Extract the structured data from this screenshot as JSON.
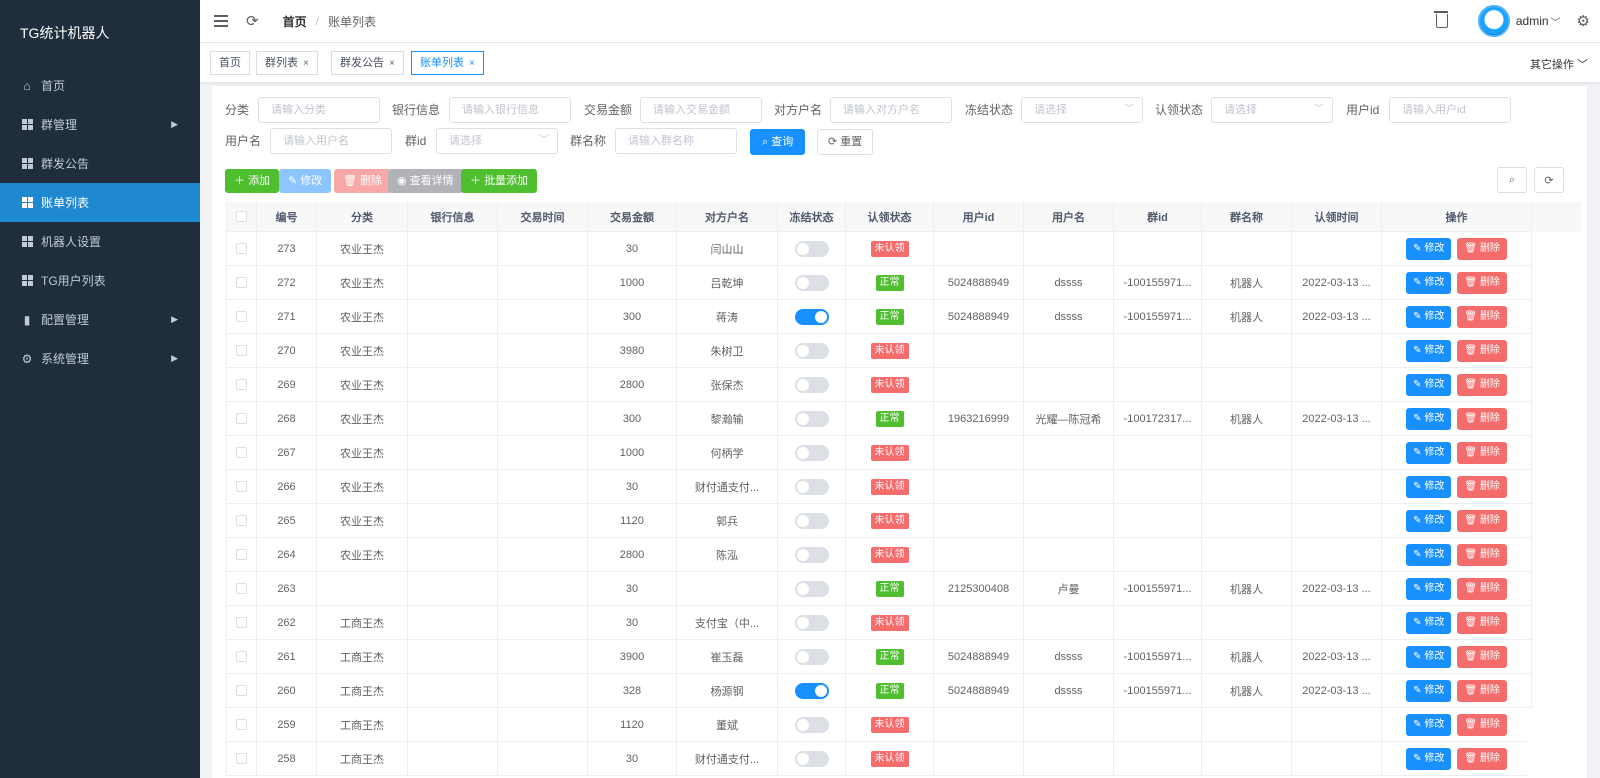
{
  "sidebar": {
    "title": "TG统计机器人",
    "items": [
      {
        "label": "首页",
        "icon": "home-icon"
      },
      {
        "label": "群管理",
        "icon": "grid-icon",
        "arrow": true
      },
      {
        "label": "群发公告",
        "icon": "grid-icon"
      },
      {
        "label": "账单列表",
        "icon": "grid-icon",
        "active": true
      },
      {
        "label": "机器人设置",
        "icon": "grid-icon"
      },
      {
        "label": "TG用户列表",
        "icon": "grid-icon"
      },
      {
        "label": "配置管理",
        "icon": "bar-chart-icon",
        "arrow": true
      },
      {
        "label": "系统管理",
        "icon": "gear-icon",
        "arrow": true
      }
    ]
  },
  "navbar": {
    "breadcrumb_home": "首页",
    "breadcrumb_sep": "/",
    "breadcrumb_current": "账单列表",
    "username": "admin"
  },
  "tags": {
    "items": [
      {
        "label": "首页"
      },
      {
        "label": "群列表",
        "closable": true
      },
      {
        "label": "群发公告",
        "closable": true
      },
      {
        "label": "账单列表",
        "closable": true,
        "active": true
      }
    ],
    "other_ops": "其它操作"
  },
  "filters": {
    "category_label": "分类",
    "category_placeholder": "请输入分类",
    "bank_label": "银行信息",
    "bank_placeholder": "请输入银行信息",
    "amount_label": "交易金额",
    "amount_placeholder": "请输入交易金额",
    "peer_label": "对方户名",
    "peer_placeholder": "请输入对方户名",
    "freeze_label": "冻结状态",
    "freeze_placeholder": "请选择",
    "claim_label": "认领状态",
    "claim_placeholder": "请选择",
    "userid_label": "用户id",
    "userid_placeholder": "请输入用户id",
    "username_label": "用户名",
    "username_placeholder": "请输入用户名",
    "groupid_label": "群id",
    "groupid_placeholder": "请选择",
    "groupname_label": "群名称",
    "groupname_placeholder": "请输入群名称",
    "search_btn": "查询",
    "reset_btn": "重置"
  },
  "toolbar": {
    "add": "添加",
    "edit": "修改",
    "delete": "删除",
    "view": "查看详情",
    "batch_add": "批量添加"
  },
  "table": {
    "headers": [
      "编号",
      "分类",
      "银行信息",
      "交易时间",
      "交易金额",
      "对方户名",
      "冻结状态",
      "认领状态",
      "用户id",
      "用户名",
      "群id",
      "群名称",
      "认领时间",
      "操作"
    ],
    "edit_label": "修改",
    "delete_label": "删除",
    "rows": [
      {
        "id": "273",
        "cat": "农业王杰",
        "amt": "30",
        "peer": "闫山山",
        "frozen": false,
        "claim": "未认领",
        "claimed": false,
        "uid": "",
        "uname": "",
        "gid": "",
        "gname": "",
        "ctime": ""
      },
      {
        "id": "272",
        "cat": "农业王杰",
        "amt": "1000",
        "peer": "吕乾坤",
        "frozen": false,
        "claim": "正常",
        "claimed": true,
        "uid": "5024888949",
        "uname": "dssss",
        "gid": "-100155971...",
        "gname": "机器人",
        "ctime": "2022-03-13 ..."
      },
      {
        "id": "271",
        "cat": "农业王杰",
        "amt": "300",
        "peer": "蒋涛",
        "frozen": true,
        "claim": "正常",
        "claimed": true,
        "uid": "5024888949",
        "uname": "dssss",
        "gid": "-100155971...",
        "gname": "机器人",
        "ctime": "2022-03-13 ..."
      },
      {
        "id": "270",
        "cat": "农业王杰",
        "amt": "3980",
        "peer": "朱树卫",
        "frozen": false,
        "claim": "未认领",
        "claimed": false,
        "uid": "",
        "uname": "",
        "gid": "",
        "gname": "",
        "ctime": ""
      },
      {
        "id": "269",
        "cat": "农业王杰",
        "amt": "2800",
        "peer": "张保杰",
        "frozen": false,
        "claim": "未认领",
        "claimed": false,
        "uid": "",
        "uname": "",
        "gid": "",
        "gname": "",
        "ctime": ""
      },
      {
        "id": "268",
        "cat": "农业王杰",
        "amt": "300",
        "peer": "黎瀚输",
        "frozen": false,
        "claim": "正常",
        "claimed": true,
        "uid": "1963216999",
        "uname": "光耀—陈冠希",
        "gid": "-100172317...",
        "gname": "机器人",
        "ctime": "2022-03-13 ..."
      },
      {
        "id": "267",
        "cat": "农业王杰",
        "amt": "1000",
        "peer": "何柄学",
        "frozen": false,
        "claim": "未认领",
        "claimed": false,
        "uid": "",
        "uname": "",
        "gid": "",
        "gname": "",
        "ctime": ""
      },
      {
        "id": "266",
        "cat": "农业王杰",
        "amt": "30",
        "peer": "财付通支付...",
        "frozen": false,
        "claim": "未认领",
        "claimed": false,
        "uid": "",
        "uname": "",
        "gid": "",
        "gname": "",
        "ctime": ""
      },
      {
        "id": "265",
        "cat": "农业王杰",
        "amt": "1120",
        "peer": "郭兵",
        "frozen": false,
        "claim": "未认领",
        "claimed": false,
        "uid": "",
        "uname": "",
        "gid": "",
        "gname": "",
        "ctime": ""
      },
      {
        "id": "264",
        "cat": "农业王杰",
        "amt": "2800",
        "peer": "陈泓",
        "frozen": false,
        "claim": "未认领",
        "claimed": false,
        "uid": "",
        "uname": "",
        "gid": "",
        "gname": "",
        "ctime": ""
      },
      {
        "id": "263",
        "cat": "",
        "amt": "30",
        "peer": "",
        "frozen": false,
        "claim": "正常",
        "claimed": true,
        "uid": "2125300408",
        "uname": "卢曼",
        "gid": "-100155971...",
        "gname": "机器人",
        "ctime": "2022-03-13 ..."
      },
      {
        "id": "262",
        "cat": "工商王杰",
        "amt": "30",
        "peer": "支付宝（中...",
        "frozen": false,
        "claim": "未认领",
        "claimed": false,
        "uid": "",
        "uname": "",
        "gid": "",
        "gname": "",
        "ctime": ""
      },
      {
        "id": "261",
        "cat": "工商王杰",
        "amt": "3900",
        "peer": "崔玉磊",
        "frozen": false,
        "claim": "正常",
        "claimed": true,
        "uid": "5024888949",
        "uname": "dssss",
        "gid": "-100155971...",
        "gname": "机器人",
        "ctime": "2022-03-13 ..."
      },
      {
        "id": "260",
        "cat": "工商王杰",
        "amt": "328",
        "peer": "杨源钢",
        "frozen": true,
        "claim": "正常",
        "claimed": true,
        "uid": "5024888949",
        "uname": "dssss",
        "gid": "-100155971...",
        "gname": "机器人",
        "ctime": "2022-03-13 ..."
      },
      {
        "id": "259",
        "cat": "工商王杰",
        "amt": "1120",
        "peer": "董斌",
        "frozen": false,
        "claim": "未认领",
        "claimed": false,
        "uid": "",
        "uname": "",
        "gid": "",
        "gname": "",
        "ctime": ""
      },
      {
        "id": "258",
        "cat": "工商王杰",
        "amt": "30",
        "peer": "财付通支付...",
        "frozen": false,
        "claim": "未认领",
        "claimed": false,
        "uid": "",
        "uname": "",
        "gid": "",
        "gname": "",
        "ctime": ""
      }
    ]
  }
}
